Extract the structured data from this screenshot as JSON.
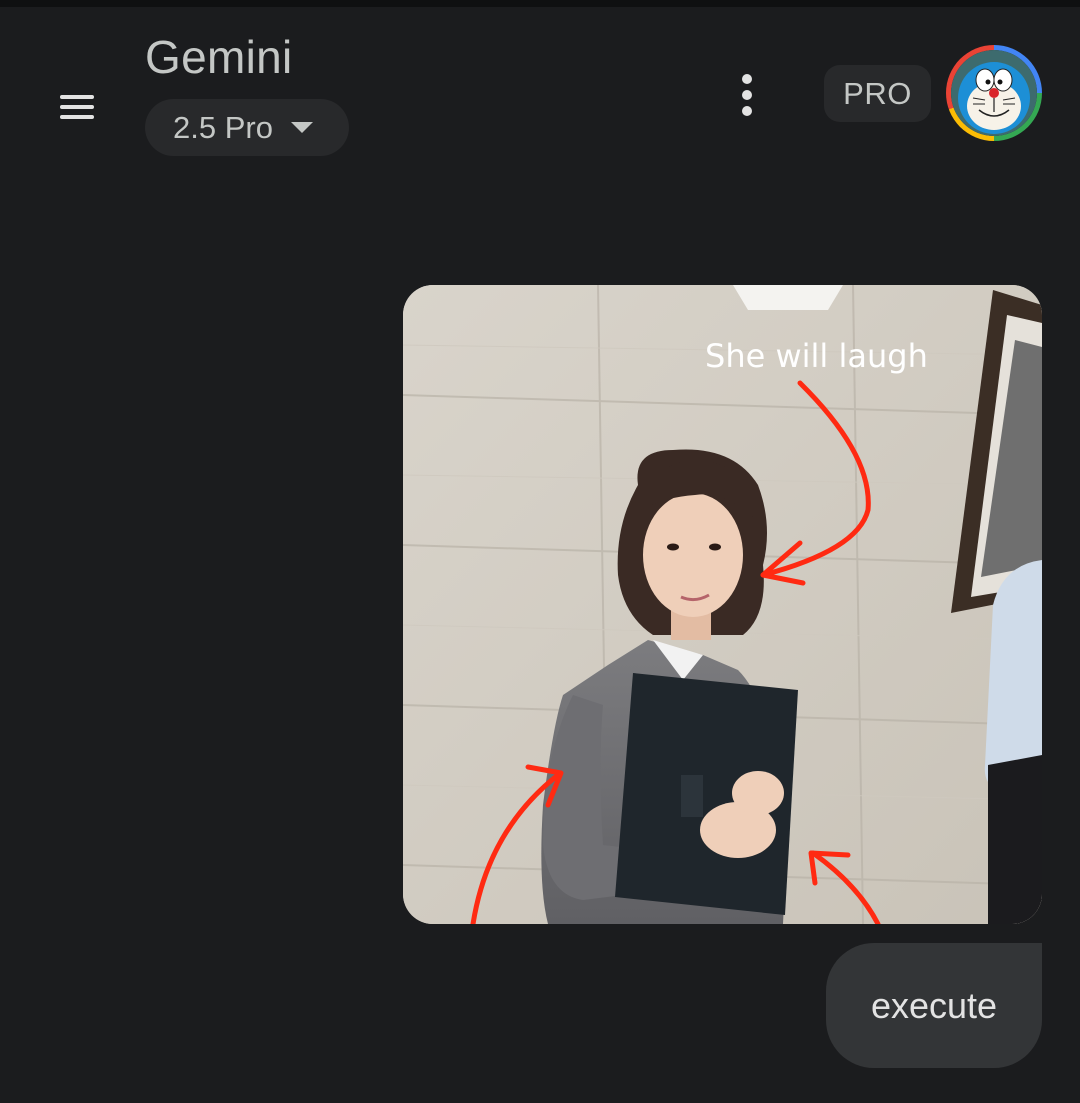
{
  "header": {
    "app_title": "Gemini",
    "model_label": "2.5 Pro",
    "badge": "PRO",
    "icons": {
      "menu": "hamburger-menu-icon",
      "more": "more-vert-icon",
      "model_caret": "caret-down-icon"
    }
  },
  "conversation": {
    "user_image": {
      "overlay_text": "She will laugh",
      "annotation_color": "#ff2a12"
    },
    "user_prompt": "execute"
  },
  "colors": {
    "background": "#1b1c1e",
    "surface": "#28292b",
    "bubble": "#333537",
    "text": "#e3e3e3"
  }
}
